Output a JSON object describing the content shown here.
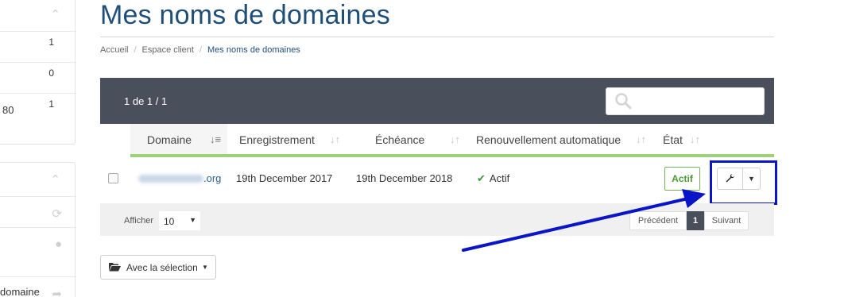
{
  "sidebar": {
    "panel1_counts": [
      "1",
      "0",
      "1"
    ],
    "panel1_row3_label": "80",
    "bottom_label": "domaine"
  },
  "page": {
    "title": "Mes noms de domaines"
  },
  "breadcrumb": {
    "items": [
      "Accueil",
      "Espace client",
      "Mes noms de domaines"
    ]
  },
  "table": {
    "count_text": "1 de 1 / 1",
    "search_placeholder": "",
    "columns": [
      "Domaine",
      "Enregistrement",
      "Échéance",
      "Renouvellement automatique",
      "État"
    ],
    "row": {
      "domain_ext": ".org",
      "registration": "19th December 2017",
      "expiry": "19th December 2018",
      "auto_renew": "Actif",
      "status": "Actif"
    },
    "footer": {
      "show_label": "Afficher",
      "per_page": "10",
      "prev": "Précédent",
      "page": "1",
      "next": "Suivant"
    }
  },
  "bulk": {
    "label": "Avec la sélection"
  },
  "colors": {
    "title": "#1f4e79",
    "header_bg": "#4a4f5c",
    "column_underline": "#9fd07a",
    "highlight": "#0a14c8"
  }
}
